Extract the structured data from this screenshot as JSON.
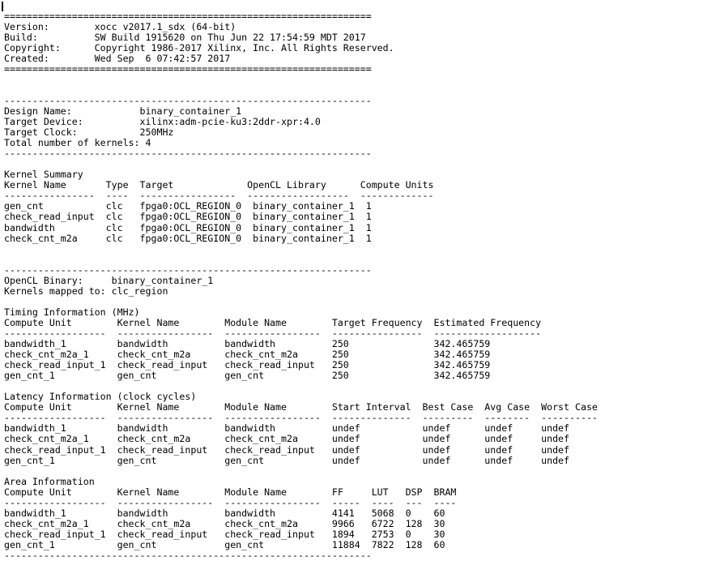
{
  "terminal": {
    "caret_glyph": "|",
    "foreground_color": "#000000",
    "background_color": "#ffffff",
    "rule_equals": "=================================================================",
    "rule_dashes": "-----------------------------------------------------------------"
  },
  "header": {
    "title_rule_top": "=================================================================",
    "rows": [
      {
        "label": "Version:",
        "value": "xocc v2017.1_sdx (64-bit)"
      },
      {
        "label": "Build:",
        "value": "SW Build 1915620 on Thu Jun 22 17:54:59 MDT 2017"
      },
      {
        "label": "Copyright:",
        "value": "Copyright 1986-2017 Xilinx, Inc. All Rights Reserved."
      },
      {
        "label": "Created:",
        "value": "Wed Sep  6 07:42:57 2017"
      }
    ],
    "title_rule_bottom": "================================================================="
  },
  "design": {
    "rows": [
      {
        "label": "Design Name:",
        "value": "binary_container_1"
      },
      {
        "label": "Target Device:",
        "value": "xilinx:adm-pcie-ku3:2ddr-xpr:4.0"
      },
      {
        "label": "Target Clock:",
        "value": "250MHz"
      },
      {
        "label": "Total number of kernels:",
        "value": "4"
      }
    ]
  },
  "kernel_summary": {
    "title": "Kernel Summary",
    "columns": [
      "Kernel Name",
      "Type",
      "Target",
      "OpenCL Library",
      "Compute Units"
    ],
    "rows": [
      [
        "gen_cnt",
        "clc",
        "fpga0:OCL_REGION_0",
        "binary_container_1",
        "1"
      ],
      [
        "check_read_input",
        "clc",
        "fpga0:OCL_REGION_0",
        "binary_container_1",
        "1"
      ],
      [
        "bandwidth",
        "clc",
        "fpga0:OCL_REGION_0",
        "binary_container_1",
        "1"
      ],
      [
        "check_cnt_m2a",
        "clc",
        "fpga0:OCL_REGION_0",
        "binary_container_1",
        "1"
      ]
    ]
  },
  "binary": {
    "rows": [
      {
        "label": "OpenCL Binary:",
        "value": "binary_container_1"
      },
      {
        "label": "Kernels mapped to:",
        "value": "clc_region"
      }
    ]
  },
  "timing": {
    "title": "Timing Information (MHz)",
    "columns": [
      "Compute Unit",
      "Kernel Name",
      "Module Name",
      "Target Frequency",
      "Estimated Frequency"
    ],
    "rows": [
      [
        "bandwidth_1",
        "bandwidth",
        "bandwidth",
        "250",
        "342.465759"
      ],
      [
        "check_cnt_m2a_1",
        "check_cnt_m2a",
        "check_cnt_m2a",
        "250",
        "342.465759"
      ],
      [
        "check_read_input_1",
        "check_read_input",
        "check_read_input",
        "250",
        "342.465759"
      ],
      [
        "gen_cnt_1",
        "gen_cnt",
        "gen_cnt",
        "250",
        "342.465759"
      ]
    ]
  },
  "latency": {
    "title": "Latency Information (clock cycles)",
    "columns": [
      "Compute Unit",
      "Kernel Name",
      "Module Name",
      "Start Interval",
      "Best Case",
      "Avg Case",
      "Worst Case"
    ],
    "rows": [
      [
        "bandwidth_1",
        "bandwidth",
        "bandwidth",
        "undef",
        "undef",
        "undef",
        "undef"
      ],
      [
        "check_cnt_m2a_1",
        "check_cnt_m2a",
        "check_cnt_m2a",
        "undef",
        "undef",
        "undef",
        "undef"
      ],
      [
        "check_read_input_1",
        "check_read_input",
        "check_read_input",
        "undef",
        "undef",
        "undef",
        "undef"
      ],
      [
        "gen_cnt_1",
        "gen_cnt",
        "gen_cnt",
        "undef",
        "undef",
        "undef",
        "undef"
      ]
    ]
  },
  "area": {
    "title": "Area Information",
    "columns": [
      "Compute Unit",
      "Kernel Name",
      "Module Name",
      "FF",
      "LUT",
      "DSP",
      "BRAM"
    ],
    "rows": [
      [
        "bandwidth_1",
        "bandwidth",
        "bandwidth",
        "4141",
        "5068",
        "0",
        "60"
      ],
      [
        "check_cnt_m2a_1",
        "check_cnt_m2a",
        "check_cnt_m2a",
        "9966",
        "6722",
        "128",
        "30"
      ],
      [
        "check_read_input_1",
        "check_read_input",
        "check_read_input",
        "1894",
        "2753",
        "0",
        "30"
      ],
      [
        "gen_cnt_1",
        "gen_cnt",
        "gen_cnt",
        "11884",
        "7822",
        "128",
        "60"
      ]
    ]
  },
  "lines": [
    "=================================================================",
    "Version:        xocc v2017.1_sdx (64-bit)",
    "Build:          SW Build 1915620 on Thu Jun 22 17:54:59 MDT 2017",
    "Copyright:      Copyright 1986-2017 Xilinx, Inc. All Rights Reserved.",
    "Created:        Wed Sep  6 07:42:57 2017",
    "=================================================================",
    "",
    "",
    "-----------------------------------------------------------------",
    "Design Name:            binary_container_1",
    "Target Device:          xilinx:adm-pcie-ku3:2ddr-xpr:4.0",
    "Target Clock:           250MHz",
    "Total number of kernels: 4",
    "-----------------------------------------------------------------",
    "",
    "Kernel Summary",
    "Kernel Name       Type  Target             OpenCL Library      Compute Units",
    "----------------  ----  -----------------  ------------------  -------------",
    "gen_cnt           clc   fpga0:OCL_REGION_0  binary_container_1  1",
    "check_read_input  clc   fpga0:OCL_REGION_0  binary_container_1  1",
    "bandwidth         clc   fpga0:OCL_REGION_0  binary_container_1  1",
    "check_cnt_m2a     clc   fpga0:OCL_REGION_0  binary_container_1  1",
    "",
    "",
    "-----------------------------------------------------------------",
    "OpenCL Binary:     binary_container_1",
    "Kernels mapped to: clc_region",
    "",
    "Timing Information (MHz)",
    "Compute Unit        Kernel Name        Module Name        Target Frequency  Estimated Frequency",
    "------------------  -----------------  -----------------  ----------------  -------------------",
    "bandwidth_1         bandwidth          bandwidth          250               342.465759",
    "check_cnt_m2a_1     check_cnt_m2a      check_cnt_m2a      250               342.465759",
    "check_read_input_1  check_read_input   check_read_input   250               342.465759",
    "gen_cnt_1           gen_cnt            gen_cnt            250               342.465759",
    "",
    "Latency Information (clock cycles)",
    "Compute Unit        Kernel Name        Module Name        Start Interval  Best Case  Avg Case  Worst Case",
    "------------------  -----------------  -----------------  --------------  ---------  --------  ----------",
    "bandwidth_1         bandwidth          bandwidth          undef           undef      undef     undef",
    "check_cnt_m2a_1     check_cnt_m2a      check_cnt_m2a      undef           undef      undef     undef",
    "check_read_input_1  check_read_input   check_read_input   undef           undef      undef     undef",
    "gen_cnt_1           gen_cnt            gen_cnt            undef           undef      undef     undef",
    "",
    "Area Information",
    "Compute Unit        Kernel Name        Module Name        FF     LUT   DSP  BRAM",
    "------------------  -----------------  -----------------  -----  ----  ---  ----",
    "bandwidth_1         bandwidth          bandwidth          4141   5068  0    60",
    "check_cnt_m2a_1     check_cnt_m2a      check_cnt_m2a      9966   6722  128  30",
    "check_read_input_1  check_read_input   check_read_input   1894   2753  0    30",
    "gen_cnt_1           gen_cnt            gen_cnt            11884  7822  128  60",
    "-----------------------------------------------------------------"
  ]
}
